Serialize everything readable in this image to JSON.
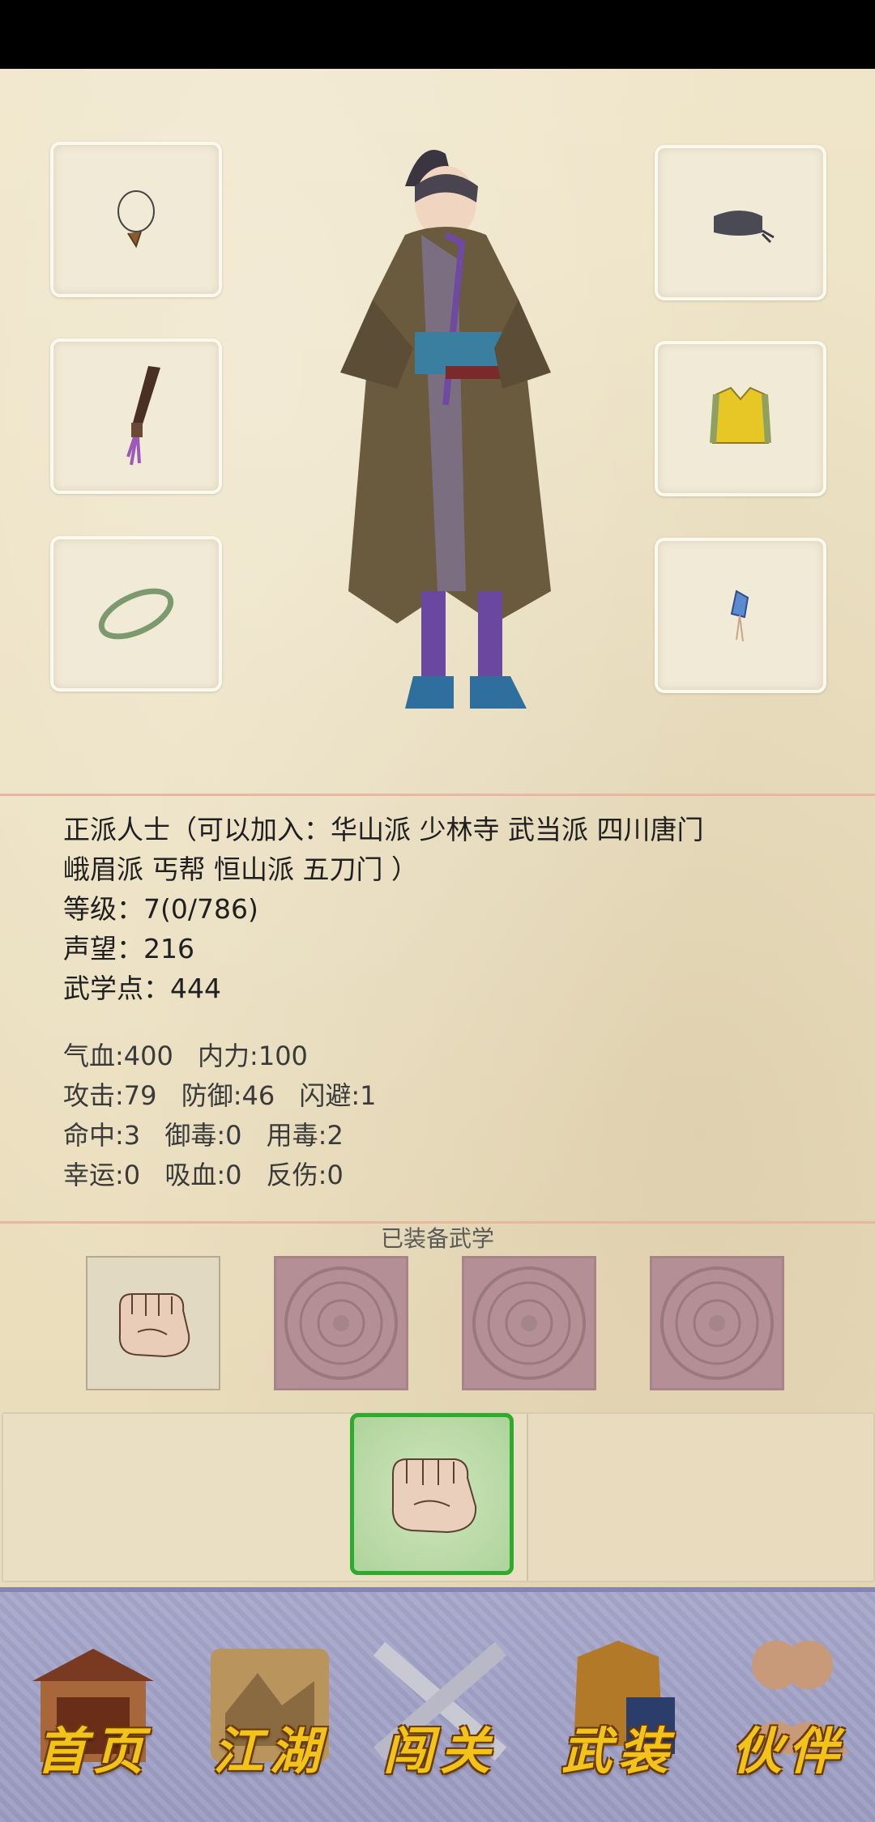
{
  "player": {
    "faction_line1": "正派人士（可以加入：华山派 少林寺 武当派 四川唐门",
    "faction_line2": "峨眉派 丐帮 恒山派 五刀门 ）",
    "level": "等级：7(0/786)",
    "reputation": "声望：216",
    "martial_points": "武学点：444"
  },
  "stats": {
    "row1": [
      "气血:400",
      "内力:100"
    ],
    "row2": [
      "攻击:79",
      "防御:46",
      "闪避:1"
    ],
    "row3": [
      "命中:3",
      "御毒:0",
      "用毒:2"
    ],
    "row4": [
      "幸运:0",
      "吸血:0",
      "反伤:0"
    ]
  },
  "equipped_title": "已装备武学",
  "equipment_slots": [
    {
      "name": "necklace",
      "icon": "necklace-icon"
    },
    {
      "name": "weapon",
      "icon": "blade-icon"
    },
    {
      "name": "bracelet",
      "icon": "bracelet-icon"
    },
    {
      "name": "hat",
      "icon": "hat-icon"
    },
    {
      "name": "armor",
      "icon": "vest-icon"
    },
    {
      "name": "pendant",
      "icon": "pendant-icon"
    }
  ],
  "nav": {
    "home": "首页",
    "jianghu": "江湖",
    "challenge": "闯关",
    "equip": "武装",
    "partner": "伙伴"
  },
  "colors": {
    "accent_selected": "#2cab2c",
    "nav_bg": "#a3a3c7",
    "nav_label": "#f2c31a"
  }
}
